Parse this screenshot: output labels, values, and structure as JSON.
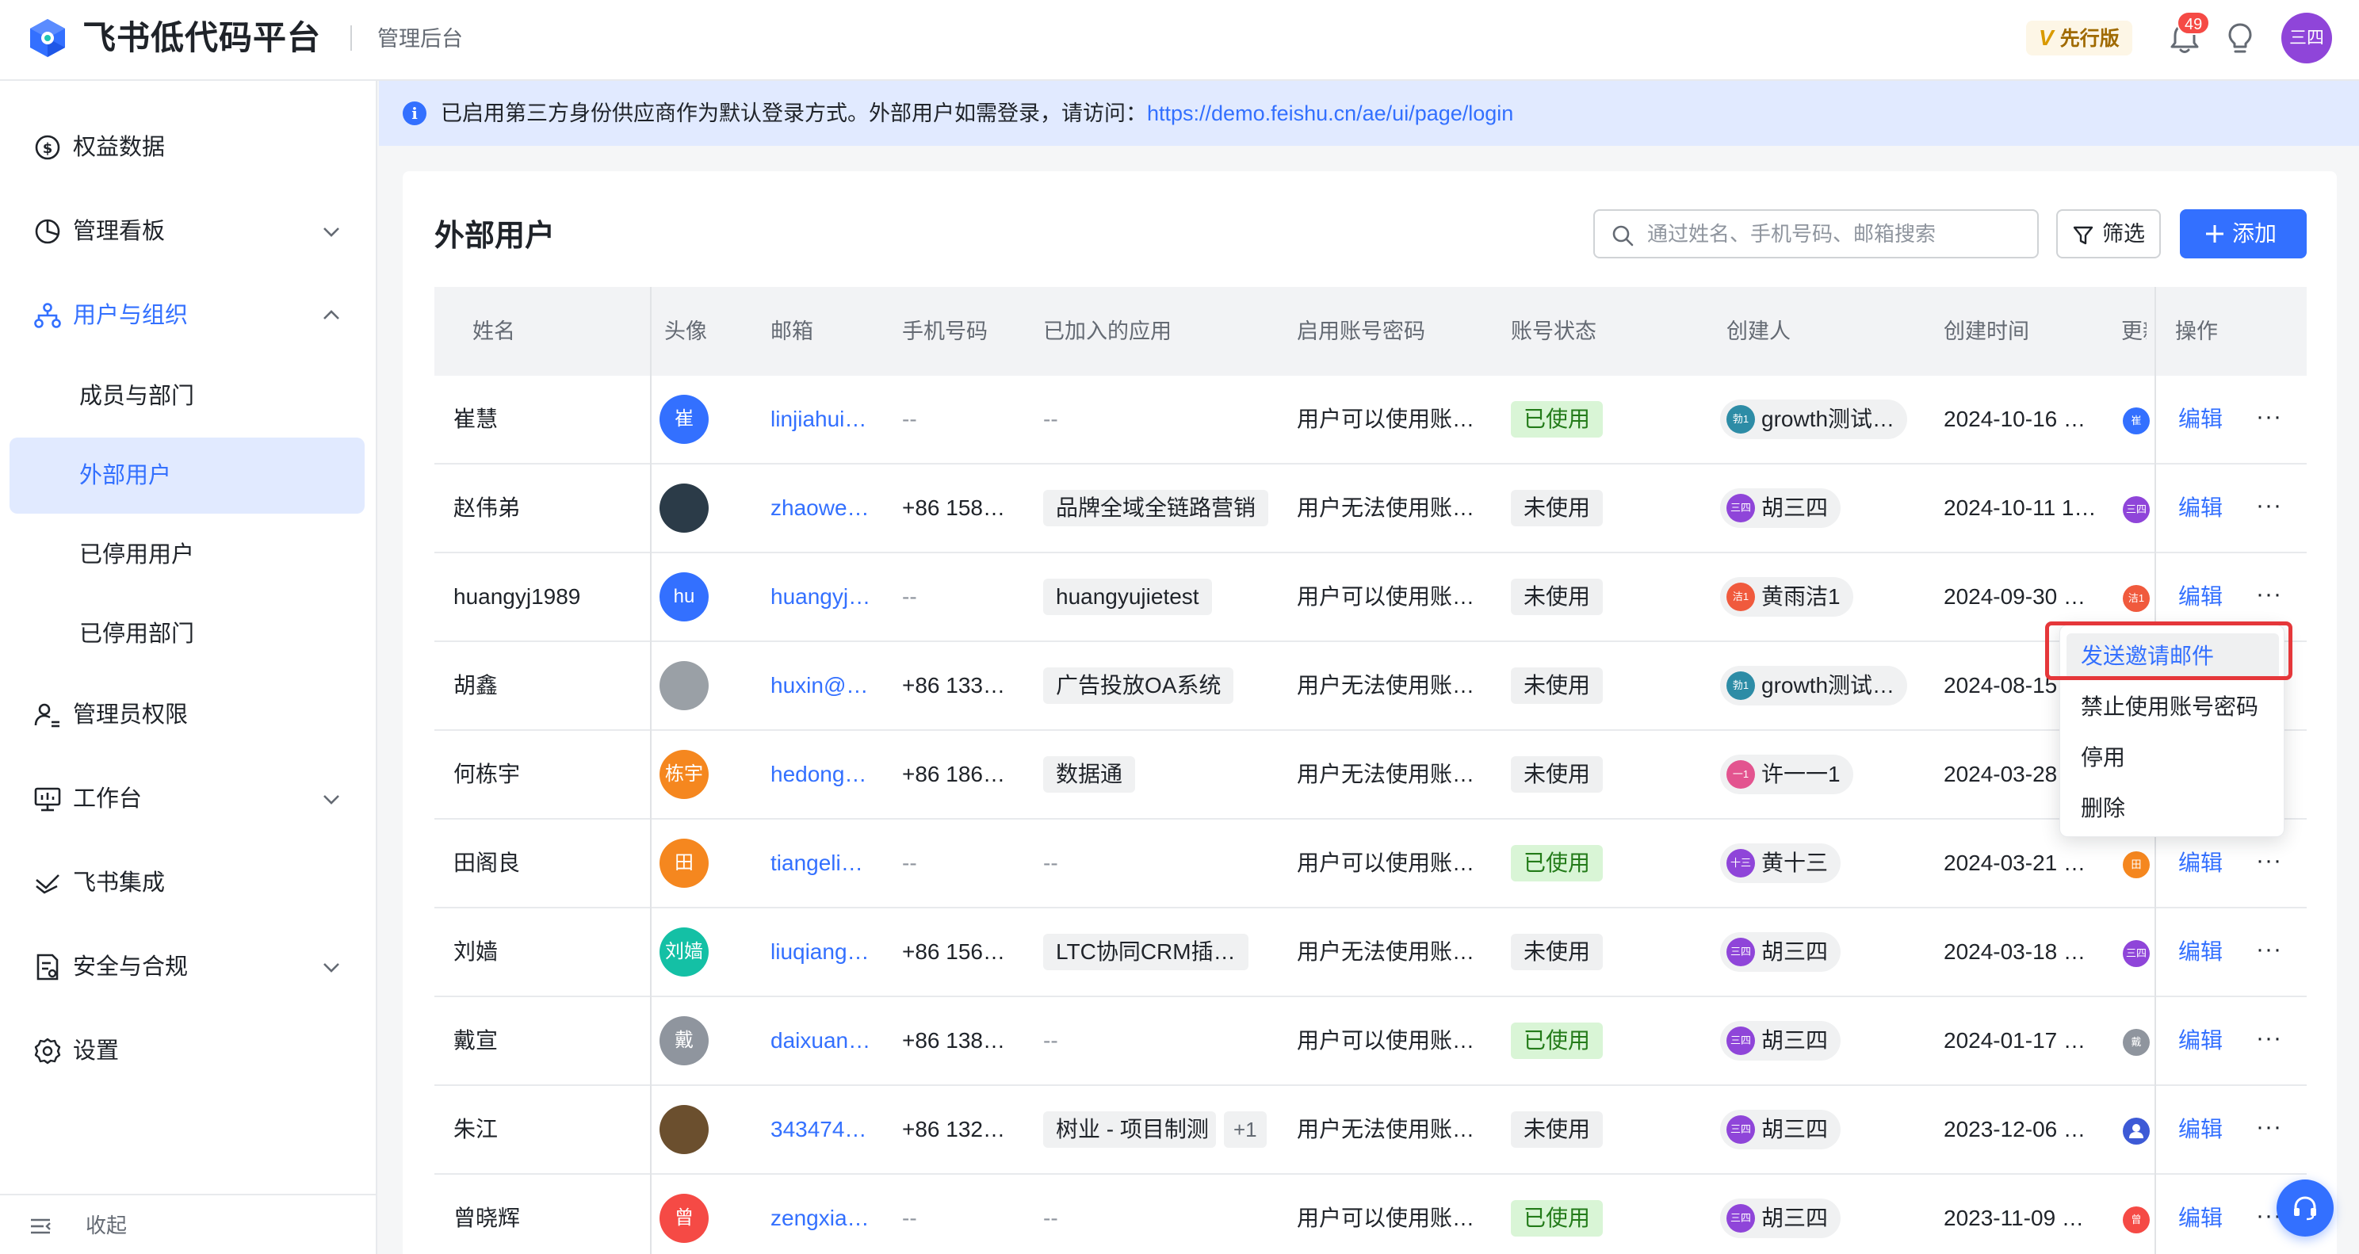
{
  "app": {
    "brand": "飞书低代码平台",
    "admin_label": "管理后台",
    "edition_v": "V",
    "edition": "先行版",
    "notification_count": "49",
    "user_avatar": "三四"
  },
  "sidebar": {
    "items": [
      {
        "label": "权益数据",
        "icon": "dollar-circle-icon"
      },
      {
        "label": "管理看板",
        "icon": "pie-chart-icon",
        "chevron": "down"
      },
      {
        "label": "用户与组织",
        "icon": "org-tree-icon",
        "chevron": "up",
        "open": true
      },
      {
        "label": "成员与部门",
        "sub": true
      },
      {
        "label": "外部用户",
        "sub": true,
        "active": true
      },
      {
        "label": "已停用用户",
        "sub": true
      },
      {
        "label": "已停用部门",
        "sub": true
      },
      {
        "label": "管理员权限",
        "icon": "admin-user-icon"
      },
      {
        "label": "工作台",
        "icon": "monitor-icon",
        "chevron": "down"
      },
      {
        "label": "飞书集成",
        "icon": "integration-icon"
      },
      {
        "label": "安全与合规",
        "icon": "security-doc-icon",
        "chevron": "down"
      },
      {
        "label": "设置",
        "icon": "gear-icon"
      }
    ],
    "collapse_label": "收起"
  },
  "notice": {
    "text": "已启用第三方身份供应商作为默认登录方式。外部用户如需登录，请访问：",
    "link": "https://demo.feishu.cn/ae/ui/page/login"
  },
  "page": {
    "title": "外部用户",
    "search_placeholder": "通过姓名、手机号码、邮箱搜索",
    "filter_label": "筛选",
    "add_label": "添加"
  },
  "table": {
    "headers": [
      "姓名",
      "头像",
      "邮箱",
      "手机号码",
      "已加入的应用",
      "启用账号密码",
      "账号状态",
      "创建人",
      "创建时间",
      "更新",
      "操作"
    ],
    "edit_label": "编辑",
    "more_label": "···",
    "rows": [
      {
        "name": "崔慧",
        "avatar": "崔",
        "avatar_color": "#3370ff",
        "email": "linjiahui…",
        "phone": "--",
        "apps": "--",
        "pwd": "用户可以使用账…",
        "status": "已使用",
        "used": true,
        "creator": "growth测试…",
        "creator_mini": "勃1",
        "creator_color": "#2d8ca6",
        "created": "2024-10-16 …",
        "upd": "崔",
        "upd_color": "#3370ff"
      },
      {
        "name": "赵伟弟",
        "avatar": "",
        "avatar_color": "#2b3b48",
        "email": "zhaowe…",
        "phone": "+86 158…",
        "apps": "品牌全域全链路营销",
        "pwd": "用户无法使用账…",
        "status": "未使用",
        "used": false,
        "creator": "胡三四",
        "creator_mini": "三四",
        "creator_color": "#8f45d9",
        "created": "2024-10-11 1…",
        "upd": "三四",
        "upd_color": "#8f45d9"
      },
      {
        "name": "huangyj1989",
        "avatar": "hu",
        "avatar_color": "#3370ff",
        "email": "huangyj…",
        "phone": "--",
        "apps": "huangyujietest",
        "pwd": "用户可以使用账…",
        "status": "未使用",
        "used": false,
        "creator": "黄雨洁1",
        "creator_mini": "洁1",
        "creator_color": "#f05a3d",
        "created": "2024-09-30 …",
        "upd": "洁1",
        "upd_color": "#f05a3d"
      },
      {
        "name": "胡鑫",
        "avatar": "",
        "avatar_color": "#9aa0a6",
        "email": "huxin@…",
        "phone": "+86 133…",
        "apps": "广告投放OA系统",
        "pwd": "用户无法使用账…",
        "status": "未使用",
        "used": false,
        "creator": "growth测试…",
        "creator_mini": "勃1",
        "creator_color": "#2d8ca6",
        "created": "2024-08-15",
        "upd": "",
        "upd_color": ""
      },
      {
        "name": "何栋宇",
        "avatar": "栋宇",
        "avatar_color": "#f5871f",
        "email": "hedong…",
        "phone": "+86 186…",
        "apps": "数据通",
        "pwd": "用户无法使用账…",
        "status": "未使用",
        "used": false,
        "creator": "许一一1",
        "creator_mini": "一1",
        "creator_color": "#e3548f",
        "created": "2024-03-28",
        "upd": "",
        "upd_color": ""
      },
      {
        "name": "田阁良",
        "avatar": "田",
        "avatar_color": "#f5871f",
        "email": "tiangeli…",
        "phone": "--",
        "apps": "--",
        "pwd": "用户可以使用账…",
        "status": "已使用",
        "used": true,
        "creator": "黄十三",
        "creator_mini": "十三",
        "creator_color": "#8f45d9",
        "created": "2024-03-21 …",
        "upd": "田",
        "upd_color": "#f5871f"
      },
      {
        "name": "刘嫱",
        "avatar": "刘嫱",
        "avatar_color": "#14c0a5",
        "email": "liuqiang…",
        "phone": "+86 156…",
        "apps": "LTC协同CRM插…",
        "pwd": "用户无法使用账…",
        "status": "未使用",
        "used": false,
        "creator": "胡三四",
        "creator_mini": "三四",
        "creator_color": "#8f45d9",
        "created": "2024-03-18 …",
        "upd": "三四",
        "upd_color": "#8f45d9"
      },
      {
        "name": "戴宣",
        "avatar": "戴",
        "avatar_color": "#8f959e",
        "email": "daixuan…",
        "phone": "+86 138…",
        "apps": "--",
        "pwd": "用户可以使用账…",
        "status": "已使用",
        "used": true,
        "creator": "胡三四",
        "creator_mini": "三四",
        "creator_color": "#8f45d9",
        "created": "2024-01-17 …",
        "upd": "戴",
        "upd_color": "#8f959e"
      },
      {
        "name": "朱江",
        "avatar": "",
        "avatar_color": "#6b4f2e",
        "email": "343474…",
        "phone": "+86 132…",
        "apps": "树业 - 项目制测",
        "apps_more": "+1",
        "pwd": "用户无法使用账…",
        "status": "未使用",
        "used": false,
        "creator": "胡三四",
        "creator_mini": "三四",
        "creator_color": "#8f45d9",
        "created": "2023-12-06 …",
        "upd": "",
        "upd_color": "#3d5ad6"
      },
      {
        "name": "曾晓辉",
        "avatar": "曾",
        "avatar_color": "#f54a45",
        "email": "zengxia…",
        "phone": "--",
        "apps": "--",
        "pwd": "用户可以使用账…",
        "status": "已使用",
        "used": true,
        "creator": "胡三四",
        "creator_mini": "三四",
        "creator_color": "#8f45d9",
        "created": "2023-11-09 …",
        "upd": "曾",
        "upd_color": "#f54a45"
      }
    ]
  },
  "dropdown": {
    "items": [
      "发送邀请邮件",
      "禁止使用账号密码",
      "停用",
      "删除"
    ]
  }
}
